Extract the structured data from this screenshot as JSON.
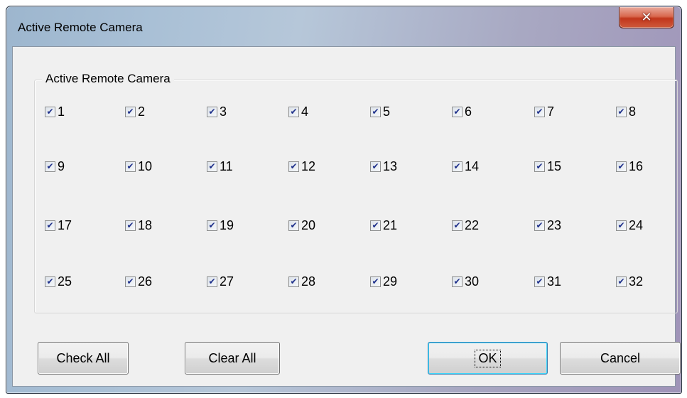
{
  "window": {
    "title": "Active Remote Camera"
  },
  "group": {
    "label": "Active Remote Camera"
  },
  "cameras": [
    {
      "label": "1",
      "checked": true
    },
    {
      "label": "2",
      "checked": true
    },
    {
      "label": "3",
      "checked": true
    },
    {
      "label": "4",
      "checked": true
    },
    {
      "label": "5",
      "checked": true
    },
    {
      "label": "6",
      "checked": true
    },
    {
      "label": "7",
      "checked": true
    },
    {
      "label": "8",
      "checked": true
    },
    {
      "label": "9",
      "checked": true
    },
    {
      "label": "10",
      "checked": true
    },
    {
      "label": "11",
      "checked": true
    },
    {
      "label": "12",
      "checked": true
    },
    {
      "label": "13",
      "checked": true
    },
    {
      "label": "14",
      "checked": true
    },
    {
      "label": "15",
      "checked": true
    },
    {
      "label": "16",
      "checked": true
    },
    {
      "label": "17",
      "checked": true
    },
    {
      "label": "18",
      "checked": true
    },
    {
      "label": "19",
      "checked": true
    },
    {
      "label": "20",
      "checked": true
    },
    {
      "label": "21",
      "checked": true
    },
    {
      "label": "22",
      "checked": true
    },
    {
      "label": "23",
      "checked": true
    },
    {
      "label": "24",
      "checked": true
    },
    {
      "label": "25",
      "checked": true
    },
    {
      "label": "26",
      "checked": true
    },
    {
      "label": "27",
      "checked": true
    },
    {
      "label": "28",
      "checked": true
    },
    {
      "label": "29",
      "checked": true
    },
    {
      "label": "30",
      "checked": true
    },
    {
      "label": "31",
      "checked": true
    },
    {
      "label": "32",
      "checked": true
    }
  ],
  "buttons": {
    "check_all": "Check All",
    "clear_all": "Clear All",
    "ok": "OK",
    "cancel": "Cancel"
  },
  "icons": {
    "close": "close-icon",
    "check": "check-icon"
  }
}
